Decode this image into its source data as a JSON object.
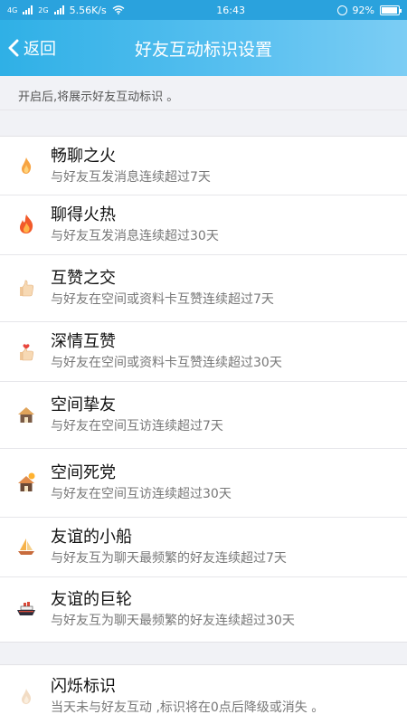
{
  "status": {
    "net": "4G",
    "net2": "2G",
    "speed": "5.56K/s",
    "time": "16:43",
    "battery": "92%",
    "battery_level": 0.92
  },
  "header": {
    "back_label": "返回",
    "title": "好友互动标识设置"
  },
  "hint": "开启后,将展示好友互动标识 。",
  "items": [
    {
      "name": "畅聊之火",
      "desc": "与好友互发消息连续超过7天",
      "icon": "small-flame-icon"
    },
    {
      "name": "聊得火热",
      "desc": "与好友互发消息连续超过30天",
      "icon": "big-flame-icon"
    },
    {
      "name": "互赞之交",
      "desc": "与好友在空间或资料卡互赞连续超过7天",
      "icon": "thumbs-up-icon"
    },
    {
      "name": "深情互赞",
      "desc": "与好友在空间或资料卡互赞连续超过30天",
      "icon": "heart-thumbs-up-icon"
    },
    {
      "name": "空间挚友",
      "desc": "与好友在空间互访连续超过7天",
      "icon": "house-icon"
    },
    {
      "name": "空间死党",
      "desc": "与好友在空间互访连续超过30天",
      "icon": "sunny-house-icon"
    },
    {
      "name": "友谊的小船",
      "desc": "与好友互为聊天最频繁的好友连续超过7天",
      "icon": "sailboat-icon"
    },
    {
      "name": "友谊的巨轮",
      "desc": "与好友互为聊天最频繁的好友连续超过30天",
      "icon": "ship-icon"
    }
  ],
  "flash": {
    "name": "闪烁标识",
    "desc": "当天未与好友互动 ,标识将在0点后降级或消失 。",
    "icon": "faded-flame-icon"
  }
}
